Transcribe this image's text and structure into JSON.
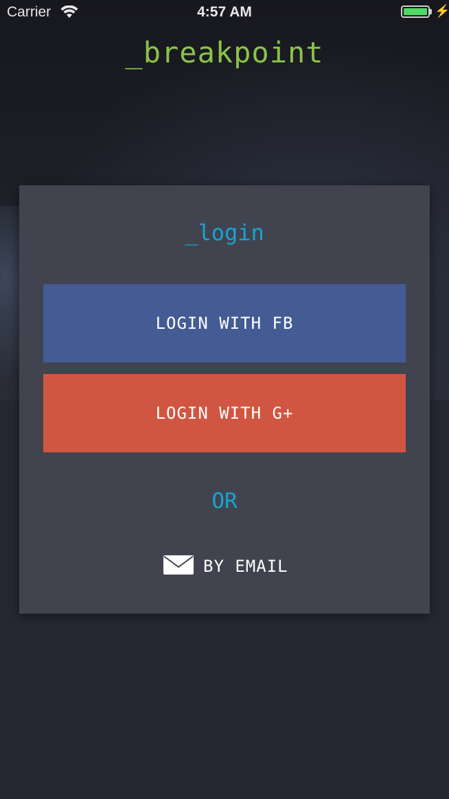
{
  "status_bar": {
    "carrier": "Carrier",
    "time": "4:57 AM"
  },
  "app": {
    "title": "_breakpoint",
    "title_color": "#8bc34a"
  },
  "login_card": {
    "title": "_login",
    "accent_color": "#18a3d2",
    "buttons": [
      {
        "label": "LOGIN WITH FB",
        "color": "#445b94"
      },
      {
        "label": "LOGIN WITH G+",
        "color": "#d15641"
      }
    ],
    "separator": "OR",
    "email_option": {
      "label": "BY EMAIL",
      "icon": "envelope-icon"
    }
  }
}
